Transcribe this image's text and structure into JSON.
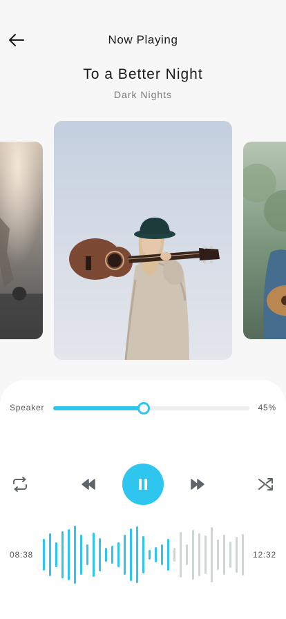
{
  "header": {
    "title": "Now Playing",
    "back_icon": "arrow-left-icon"
  },
  "song": {
    "title": "To a Better Night",
    "artist": "Dark Nights"
  },
  "carousel": {
    "covers": [
      {
        "name": "previous-cover",
        "subject": "concert stage"
      },
      {
        "name": "current-cover",
        "subject": "woman carrying acoustic guitar"
      },
      {
        "name": "next-cover",
        "subject": "man playing guitar outdoors"
      }
    ]
  },
  "volume": {
    "label": "Speaker",
    "value_text": "45%",
    "level": 0.45
  },
  "controls": {
    "repeat_icon": "repeat-icon",
    "rewind_icon": "rewind-icon",
    "play_icon": "pause-icon",
    "forward_icon": "fast-forward-icon",
    "shuffle_icon": "shuffle-icon"
  },
  "progress": {
    "elapsed": "08:38",
    "total": "12:32",
    "played_fraction": 0.6
  },
  "colors": {
    "accent": "#2ec5ee",
    "unplayed_wave": "#cfd4d6",
    "background": "#f7f7f7",
    "panel": "#ffffff"
  }
}
